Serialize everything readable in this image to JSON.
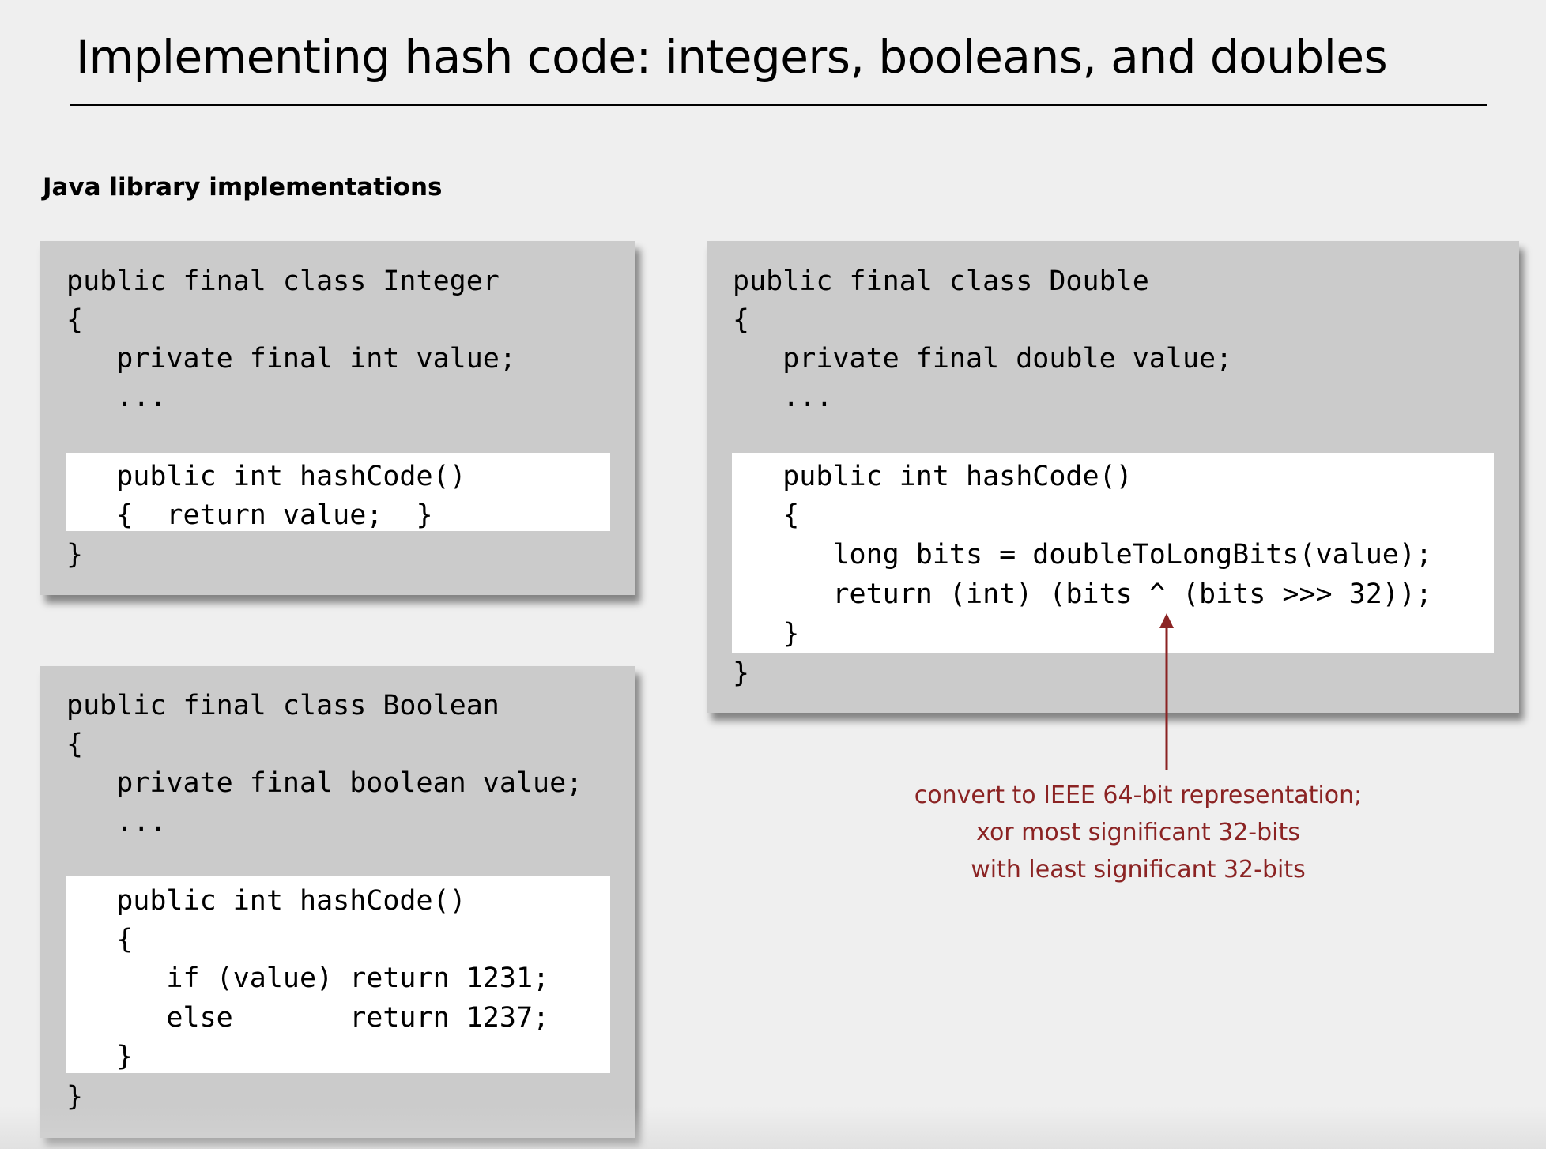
{
  "slide": {
    "title": "Implementing hash code:  integers, booleans, and doubles",
    "section_label": "Java library implementations"
  },
  "integer_panel": {
    "lines": [
      "public final class Integer",
      "{",
      "   private final int value;",
      "   ...",
      "   public int hashCode()",
      "   {  return value;  }",
      "}"
    ]
  },
  "boolean_panel": {
    "lines": [
      "public final class Boolean",
      "{",
      "   private final boolean value;",
      "   ...",
      "   public int hashCode()",
      "   {",
      "      if (value) return 1231;",
      "      else       return 1237;",
      "   }",
      "}"
    ]
  },
  "double_panel": {
    "lines": [
      "public final class Double",
      "{",
      "   private final double value;",
      "   ...",
      "   public int hashCode()",
      "   {",
      "      long bits = doubleToLongBits(value);",
      "      return (int) (bits ^ (bits >>> 32));",
      "   }",
      "}"
    ]
  },
  "annotation": {
    "lines": [
      "convert to IEEE 64-bit representation;",
      "xor most significant 32-bits",
      "with least significant 32-bits"
    ],
    "color": "#8b2323"
  },
  "colors": {
    "background": "#efefef",
    "panel": "#cbcbcb",
    "highlight": "#ffffff",
    "accent": "#8b2323"
  }
}
